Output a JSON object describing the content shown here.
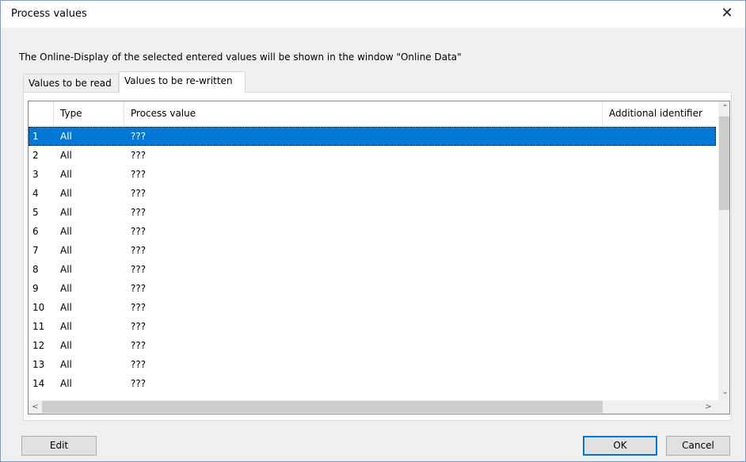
{
  "dialog": {
    "title": "Process values",
    "close_glyph": "✕",
    "info_text": "The Online-Display of the selected entered values will be shown in the window \"Online Data\""
  },
  "tabs": [
    {
      "label": "Values to be read",
      "selected": false
    },
    {
      "label": "Values to be re-written",
      "selected": true
    }
  ],
  "grid": {
    "columns": [
      "",
      "Type",
      "Process value",
      "Additional identifier"
    ],
    "rows": [
      {
        "num": "1",
        "type": "All",
        "value": "???",
        "selected": true
      },
      {
        "num": "2",
        "type": "All",
        "value": "???"
      },
      {
        "num": "3",
        "type": "All",
        "value": "???"
      },
      {
        "num": "4",
        "type": "All",
        "value": "???"
      },
      {
        "num": "5",
        "type": "All",
        "value": "???"
      },
      {
        "num": "6",
        "type": "All",
        "value": "???"
      },
      {
        "num": "7",
        "type": "All",
        "value": "???"
      },
      {
        "num": "8",
        "type": "All",
        "value": "???"
      },
      {
        "num": "9",
        "type": "All",
        "value": "???"
      },
      {
        "num": "10",
        "type": "All",
        "value": "???"
      },
      {
        "num": "11",
        "type": "All",
        "value": "???"
      },
      {
        "num": "12",
        "type": "All",
        "value": "???"
      },
      {
        "num": "13",
        "type": "All",
        "value": "???"
      },
      {
        "num": "14",
        "type": "All",
        "value": "???"
      }
    ],
    "scroll_up_glyph": "⌃",
    "scroll_down_glyph": "⌄",
    "scroll_left_glyph": "<",
    "scroll_right_glyph": ">"
  },
  "buttons": {
    "edit": "Edit",
    "ok": "OK",
    "cancel": "Cancel"
  },
  "colors": {
    "selection": "#0078d7",
    "default_button_border": "#0078d7"
  }
}
